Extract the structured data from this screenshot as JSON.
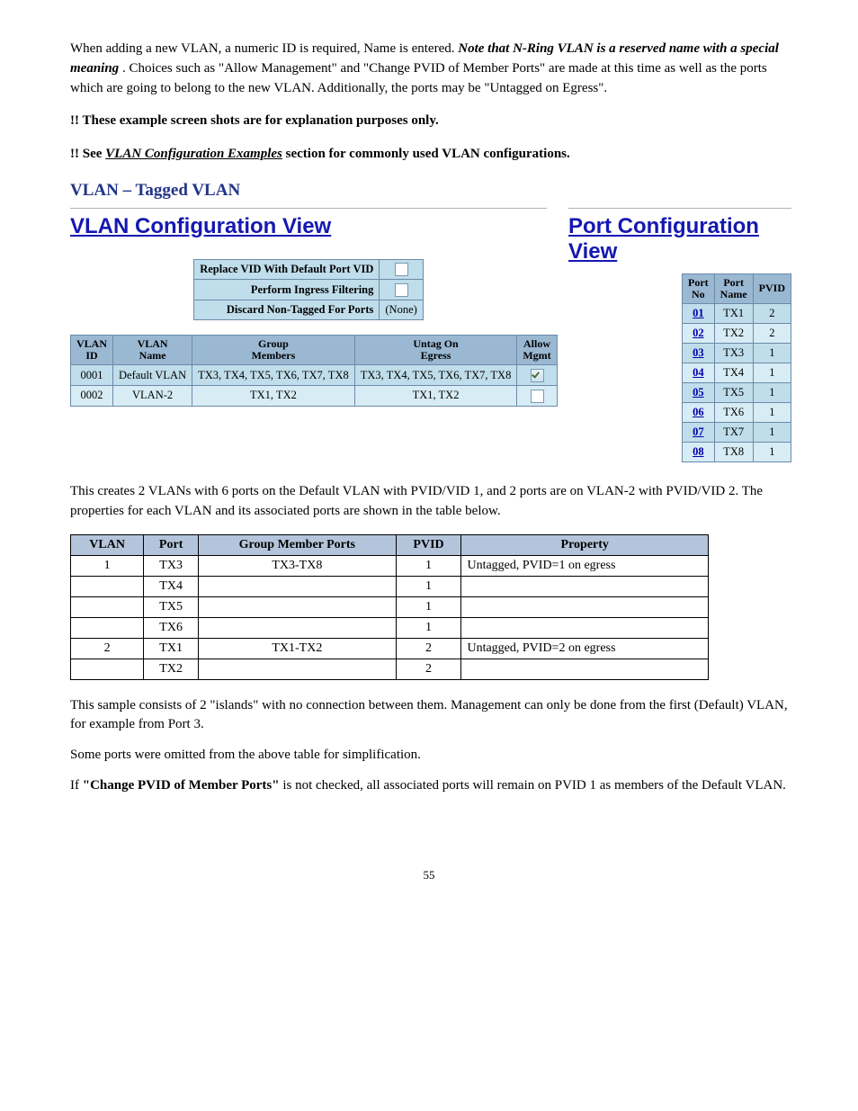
{
  "intro": {
    "line1a": "When adding a new VLAN, a numeric ID is required, Name is entered. ",
    "line1b": "Note that N-Ring VLAN is a reserved name with a special meaning",
    "line1c": ". Choices such as \"Allow Management\" and \"Change PVID of Member Ports\" are made at this time as well as the ports which are going to belong to the new VLAN. Additionally, the ports may be \"Untagged on Egress\".",
    "bang1": "These example screen shots are for explanation purposes only.",
    "bang2a": "See ",
    "bang2b": " section for commonly used VLAN configurations.",
    "vlan_conf_link": "VLAN Configuration Examples"
  },
  "headings": {
    "tagged_vlan": "VLAN – Tagged VLAN",
    "vlan_conf_view": "VLAN Configuration View",
    "port_conf_view": "Port Configuration View"
  },
  "vlan_options": {
    "replace_vid_label": "Replace VID With Default Port VID",
    "replace_vid_checked": false,
    "ingress_label": "Perform Ingress Filtering",
    "ingress_checked": false,
    "discard_label": "Discard Non-Tagged For Ports",
    "discard_value": "(None)"
  },
  "vlan_table": {
    "headers": {
      "id": "VLAN\nID",
      "name": "VLAN\nName",
      "group": "Group\nMembers",
      "untag": "Untag On\nEgress",
      "mgmt": "Allow\nMgmt"
    },
    "rows": [
      {
        "id": "0001",
        "name": "Default VLAN",
        "group": "TX3, TX4, TX5, TX6, TX7, TX8",
        "untag": "TX3, TX4, TX5, TX6, TX7, TX8",
        "mgmt_checked": true
      },
      {
        "id": "0002",
        "name": "VLAN-2",
        "group": "TX1, TX2",
        "untag": "TX1, TX2",
        "mgmt_checked": false
      }
    ]
  },
  "port_table": {
    "headers": {
      "no": "Port\nNo",
      "name": "Port\nName",
      "pvid": "PVID"
    },
    "rows": [
      {
        "no": "01",
        "name": "TX1",
        "pvid": "2"
      },
      {
        "no": "02",
        "name": "TX2",
        "pvid": "2"
      },
      {
        "no": "03",
        "name": "TX3",
        "pvid": "1"
      },
      {
        "no": "04",
        "name": "TX4",
        "pvid": "1"
      },
      {
        "no": "05",
        "name": "TX5",
        "pvid": "1"
      },
      {
        "no": "06",
        "name": "TX6",
        "pvid": "1"
      },
      {
        "no": "07",
        "name": "TX7",
        "pvid": "1"
      },
      {
        "no": "08",
        "name": "TX8",
        "pvid": "1"
      }
    ]
  },
  "result_text": "This creates 2 VLANs with 6 ports on the Default VLAN with PVID/VID 1, and 2 ports are on VLAN-2 with PVID/VID 2. The properties for each VLAN and its associated ports are shown in the table below.",
  "props_table": {
    "headers": {
      "vlan": "VLAN",
      "port": "Port",
      "group": "Group Member Ports",
      "pvid": "PVID",
      "property": "Property"
    },
    "rows": [
      {
        "vlan": "1",
        "port": "TX3",
        "group": "TX3-TX8",
        "pvid": "1",
        "property": "Untagged, PVID=1 on egress"
      },
      {
        "vlan": "",
        "port": "TX4",
        "group": "",
        "pvid": "1",
        "property": ""
      },
      {
        "vlan": "",
        "port": "TX5",
        "group": "",
        "pvid": "1",
        "property": ""
      },
      {
        "vlan": "",
        "port": "TX6",
        "group": "",
        "pvid": "1",
        "property": ""
      },
      {
        "vlan": "2",
        "port": "TX1",
        "group": "TX1-TX2",
        "pvid": "2",
        "property": "Untagged, PVID=2 on egress"
      },
      {
        "vlan": "",
        "port": "TX2",
        "group": "",
        "pvid": "2",
        "property": ""
      }
    ]
  },
  "closing": {
    "p1": "This sample consists of 2 \"islands\" with no connection between them. Management can only be done from the first (Default) VLAN, for example from Port 3.",
    "p2": "Some ports were omitted from the above table for simplification.",
    "p3a": "If ",
    "p3b": "\"Change PVID of Member Ports\"",
    "p3c": " is not checked, all associated ports will remain on PVID 1 as members of the Default VLAN."
  },
  "page_number": "55"
}
